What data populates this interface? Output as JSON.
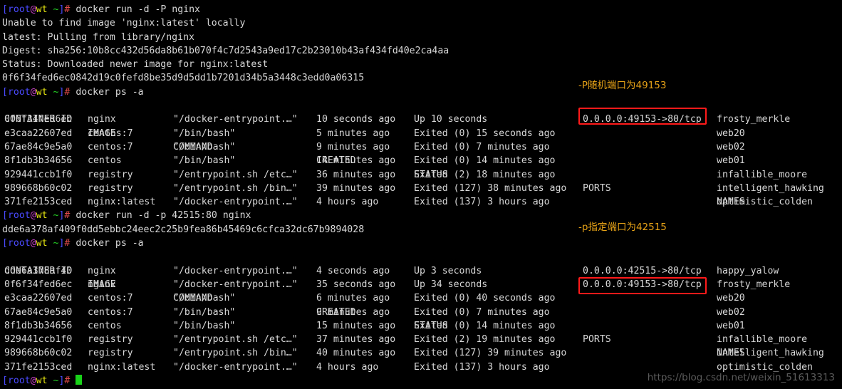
{
  "terminal": {
    "prompt": {
      "open_bracket": "[",
      "user": "root",
      "at": "@",
      "host": "wt",
      "path": "~",
      "close_bracket": "]",
      "sigil": "#"
    },
    "colors": {
      "background": "#000000",
      "foreground": "#d8d8d8",
      "prompt_blue": "#4a4aff",
      "prompt_magenta": "#cc44cc",
      "prompt_yellow": "#e5e510",
      "prompt_green": "#26d826",
      "prompt_red": "#e04b4b",
      "annotation_orange": "#e8a317",
      "highlight_red": "#ff1a1a",
      "cursor_green": "#19d219",
      "watermark_gray": "#5b5b5b"
    }
  },
  "commands": {
    "run_P": "docker run -d -P nginx",
    "ps_a_1": "docker ps -a",
    "run_p": "docker run -d -p 42515:80 nginx",
    "ps_a_2": "docker ps -a"
  },
  "pull_output": {
    "unable": "Unable to find image 'nginx:latest' locally",
    "pulling": "latest: Pulling from library/nginx",
    "digest": "Digest: sha256:10b8cc432d56da8b61b070f4c7d2543a9ed17c2b23010b43af434fd40e2ca4aa",
    "status": "Status: Downloaded newer image for nginx:latest",
    "container_id": "0f6f34fed6ec0842d19c0fefd8be35d9d5dd1b7201d34b5a3448c3edd0a06315"
  },
  "run_p_output": {
    "container_id": "dde6a378af409f0dd5ebbc24eec2c25b9fea86b45469c6cfca32dc67b9894028"
  },
  "table_headers": {
    "container_id": "CONTAINER ID",
    "image": "IMAGE",
    "command": "COMMAND",
    "created": "CREATED",
    "status": "STATUS",
    "ports": "PORTS",
    "names": "NAMES"
  },
  "table1": {
    "rows": [
      {
        "id": "0f6f34fed6ec",
        "image": "nginx",
        "command": "\"/docker-entrypoint.…\"",
        "created": "10 seconds ago",
        "status": "Up 10 seconds",
        "ports": "0.0.0.0:49153->80/tcp",
        "names": "frosty_merkle"
      },
      {
        "id": "e3caa22607ed",
        "image": "centos:7",
        "command": "\"/bin/bash\"",
        "created": "5 minutes ago",
        "status": "Exited (0) 15 seconds ago",
        "ports": "",
        "names": "web20"
      },
      {
        "id": "67ae84c9e5a0",
        "image": "centos:7",
        "command": "\"/bin/bash\"",
        "created": "9 minutes ago",
        "status": "Exited (0) 7 minutes ago",
        "ports": "",
        "names": "web02"
      },
      {
        "id": "8f1db3b34656",
        "image": "centos",
        "command": "\"/bin/bash\"",
        "created": "14 minutes ago",
        "status": "Exited (0) 14 minutes ago",
        "ports": "",
        "names": "web01"
      },
      {
        "id": "929441ccb1f0",
        "image": "registry",
        "command": "\"/entrypoint.sh /etc…\"",
        "created": "36 minutes ago",
        "status": "Exited (2) 18 minutes ago",
        "ports": "",
        "names": "infallible_moore"
      },
      {
        "id": "989668b60c02",
        "image": "registry",
        "command": "\"/entrypoint.sh /bin…\"",
        "created": "39 minutes ago",
        "status": "Exited (127) 38 minutes ago",
        "ports": "",
        "names": "intelligent_hawking"
      },
      {
        "id": "371fe2153ced",
        "image": "nginx:latest",
        "command": "\"/docker-entrypoint.…\"",
        "created": "4 hours ago",
        "status": "Exited (137) 3 hours ago",
        "ports": "",
        "names": "optimistic_colden"
      }
    ]
  },
  "table2": {
    "rows": [
      {
        "id": "dde6a378af40",
        "image": "nginx",
        "command": "\"/docker-entrypoint.…\"",
        "created": "4 seconds ago",
        "status": "Up 3 seconds",
        "ports": "0.0.0.0:42515->80/tcp",
        "names": "happy_yalow"
      },
      {
        "id": "0f6f34fed6ec",
        "image": "nginx",
        "command": "\"/docker-entrypoint.…\"",
        "created": "35 seconds ago",
        "status": "Up 34 seconds",
        "ports": "0.0.0.0:49153->80/tcp",
        "names": "frosty_merkle"
      },
      {
        "id": "e3caa22607ed",
        "image": "centos:7",
        "command": "\"/bin/bash\"",
        "created": "6 minutes ago",
        "status": "Exited (0) 40 seconds ago",
        "ports": "",
        "names": "web20"
      },
      {
        "id": "67ae84c9e5a0",
        "image": "centos:7",
        "command": "\"/bin/bash\"",
        "created": "9 minutes ago",
        "status": "Exited (0) 7 minutes ago",
        "ports": "",
        "names": "web02"
      },
      {
        "id": "8f1db3b34656",
        "image": "centos",
        "command": "\"/bin/bash\"",
        "created": "15 minutes ago",
        "status": "Exited (0) 14 minutes ago",
        "ports": "",
        "names": "web01"
      },
      {
        "id": "929441ccb1f0",
        "image": "registry",
        "command": "\"/entrypoint.sh /etc…\"",
        "created": "37 minutes ago",
        "status": "Exited (2) 19 minutes ago",
        "ports": "",
        "names": "infallible_moore"
      },
      {
        "id": "989668b60c02",
        "image": "registry",
        "command": "\"/entrypoint.sh /bin…\"",
        "created": "40 minutes ago",
        "status": "Exited (127) 39 minutes ago",
        "ports": "",
        "names": "intelligent_hawking"
      },
      {
        "id": "371fe2153ced",
        "image": "nginx:latest",
        "command": "\"/docker-entrypoint.…\"",
        "created": "4 hours ago",
        "status": "Exited (137) 3 hours ago",
        "ports": "",
        "names": "optimistic_colden"
      }
    ]
  },
  "annotations": {
    "random_port": "-P随机端口为49153",
    "fixed_port": "-p指定端口为42515"
  },
  "watermark": {
    "text": "https://blog.csdn.net/weixin_51613313"
  }
}
